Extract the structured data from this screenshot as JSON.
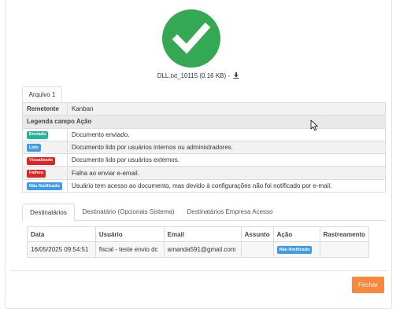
{
  "colors": {
    "success": "#34a853",
    "badge_enviado": "#27b599",
    "badge_lido": "#3d9be9",
    "badge_visualizado": "#e02424",
    "badge_falhou": "#e02424",
    "badge_nao_notificado": "#3d9be9",
    "close_button": "#f7883e"
  },
  "icons": {
    "status": "check-circle-icon",
    "download": "download-icon",
    "cursor": "mouse-pointer-icon"
  },
  "file": {
    "name": "DLL.txt_10115 (0.16 KB) -"
  },
  "file_tab": {
    "label": "Arquivo 1"
  },
  "info": {
    "remetente_label": "Remetente",
    "remetente_value": "Kanban",
    "legend_title": "Legenda campo Ação",
    "legend": [
      {
        "badge": "Enviado",
        "description": "Documento enviado."
      },
      {
        "badge": "Lido",
        "description": "Documento lido por usuários internos ou administradores."
      },
      {
        "badge": "Visualizado",
        "description": "Documento lido por usuários externos."
      },
      {
        "badge": "Falhou",
        "description": "Falha ao enviar e-email."
      },
      {
        "badge": "Não Notificado",
        "description": "Usuário tem acesso ao documento, mas devido à configurações não foi notificado por e-mail."
      }
    ]
  },
  "recipient_tabs": [
    {
      "label": "Destinatários"
    },
    {
      "label": "Destinatário (Opcionais Sistema)"
    },
    {
      "label": "Destinatários Empresa Acesso"
    }
  ],
  "table": {
    "headers": [
      "Data",
      "Usuário",
      "Email",
      "Assunto",
      "Ação",
      "Rastreamento"
    ],
    "rows": [
      {
        "data": "16/05/2025 09:54:51",
        "usuario": "fiscal - teste envio dc",
        "email": "amanda591@gmail.com",
        "assunto": "",
        "acao": "Não Notificado",
        "rastreamento": ""
      }
    ]
  },
  "footer": {
    "close_label": "Fechar"
  }
}
